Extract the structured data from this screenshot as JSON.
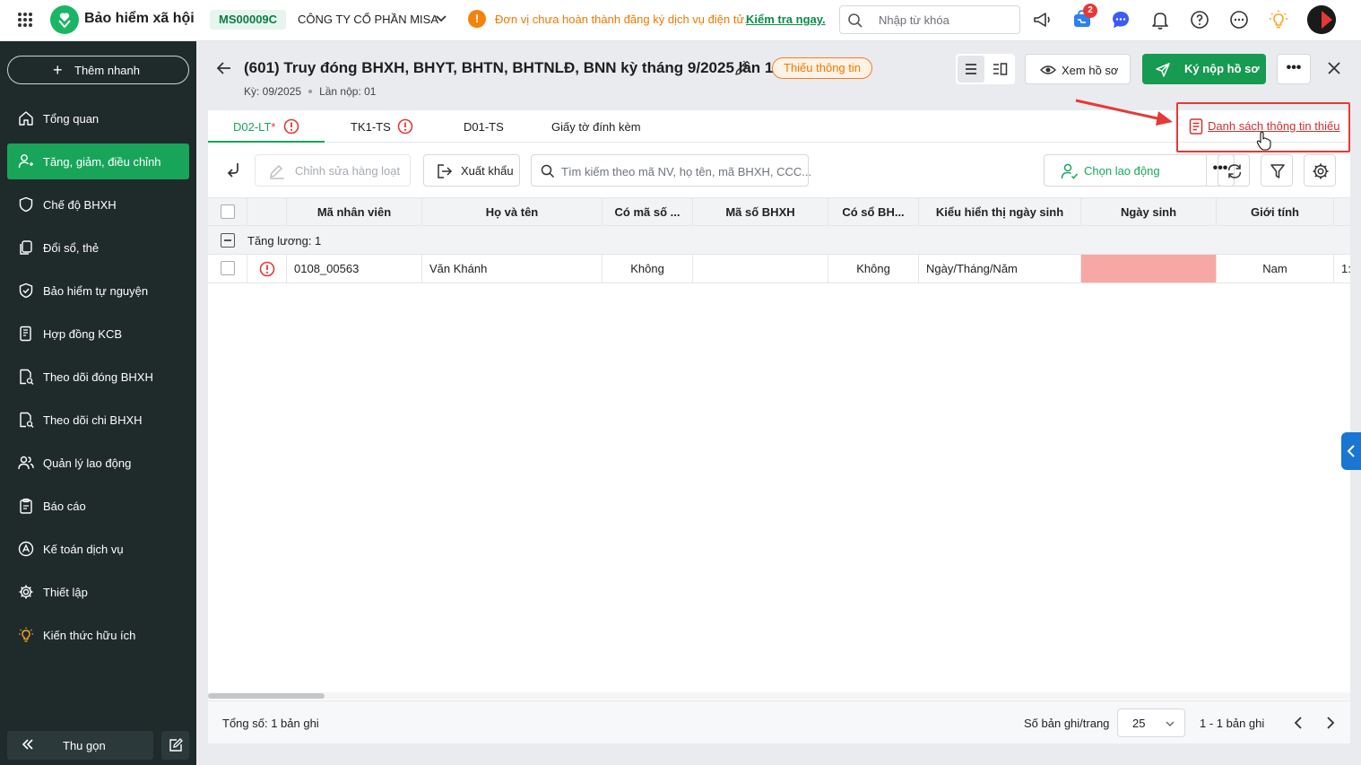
{
  "topbar": {
    "app_title": "Bảo hiểm xã hội",
    "company_code": "MS00009C",
    "company_name": "CÔNG TY CỔ PHẦN MISA",
    "warning_text": "Đơn vị chưa hoàn thành đăng ký dịch vụ điện tử.",
    "warning_link": "Kiểm tra ngay.",
    "search_placeholder": "Nhập từ khóa",
    "cart_badge": "2"
  },
  "sidebar": {
    "quick_add": "Thêm nhanh",
    "items": [
      {
        "label": "Tổng quan",
        "icon": "home-icon"
      },
      {
        "label": "Tăng, giảm, điều chỉnh",
        "icon": "user-adjust-icon",
        "active": true
      },
      {
        "label": "Chế độ BHXH",
        "icon": "shield-icon"
      },
      {
        "label": "Đổi sổ, thẻ",
        "icon": "copy-icon"
      },
      {
        "label": "Bảo hiểm tự nguyện",
        "icon": "shield-check-icon"
      },
      {
        "label": "Hợp đồng KCB",
        "icon": "contract-icon"
      },
      {
        "label": "Theo dõi đóng BHXH",
        "icon": "document-track-icon"
      },
      {
        "label": "Theo dõi chi BHXH",
        "icon": "document-track-icon"
      },
      {
        "label": "Quản lý lao động",
        "icon": "users-icon"
      },
      {
        "label": "Báo cáo",
        "icon": "clipboard-icon"
      },
      {
        "label": "Kế toán dịch vụ",
        "icon": "accounting-icon"
      },
      {
        "label": "Thiết lập",
        "icon": "gear-icon"
      },
      {
        "label": "Kiến thức hữu ích",
        "icon": "lightbulb-icon"
      }
    ],
    "collapse_label": "Thu gọn"
  },
  "header": {
    "title": "(601) Truy đóng BHXH, BHYT, BHTN, BHTNLĐ, BNN kỳ tháng 9/2025 lần 1",
    "status": "Thiếu thông tin",
    "period": "Kỳ: 09/2025",
    "submission": "Lần nộp: 01",
    "view_button": "Xem hồ sơ",
    "submit_button": "Ký nộp hồ sơ"
  },
  "tabs": [
    {
      "label": "D02-LT",
      "required_mark": "*",
      "error": true,
      "active": true
    },
    {
      "label": "TK1-TS",
      "required_mark": "",
      "error": true,
      "active": false
    },
    {
      "label": "D01-TS",
      "required_mark": "",
      "error": false,
      "active": false
    },
    {
      "label": "Giấy tờ đính kèm",
      "required_mark": "",
      "error": false,
      "active": false
    }
  ],
  "missing_info_link": "Danh sách thông tin thiếu",
  "toolbar": {
    "bulk_edit": "Chỉnh sửa hàng loạt",
    "export": "Xuất khẩu",
    "search_placeholder": "Tìm kiếm theo mã NV, họ tên, mã BHXH, CCC...",
    "choose_employee": "Chọn lao động"
  },
  "table": {
    "columns": [
      "Mã nhân viên",
      "Họ và tên",
      "Có mã số ...",
      "Mã số BHXH",
      "Có sổ BH...",
      "Kiểu hiển thị ngày sinh",
      "Ngày sinh",
      "Giới tính"
    ],
    "group_label": "Tăng lương: 1",
    "rows": [
      {
        "employee_id": "0108_00563",
        "full_name": "Văn Khánh",
        "has_code": "Không",
        "bhxh_code": "",
        "has_book": "Không",
        "dob_format": "Ngày/Tháng/Năm",
        "dob": "",
        "gender": "Nam",
        "extra": "1:"
      }
    ]
  },
  "footer": {
    "total": "Tổng số: 1 bản ghi",
    "per_page_label": "Số bản ghi/trang",
    "per_page": "25",
    "range": "1 - 1 bản ghi"
  },
  "colors": {
    "primary": "#18a55a",
    "warning": "#f07800",
    "error": "#e53935",
    "sidebar_bg": "#1f2a2b",
    "highlight_cell": "#f7a8a4"
  }
}
